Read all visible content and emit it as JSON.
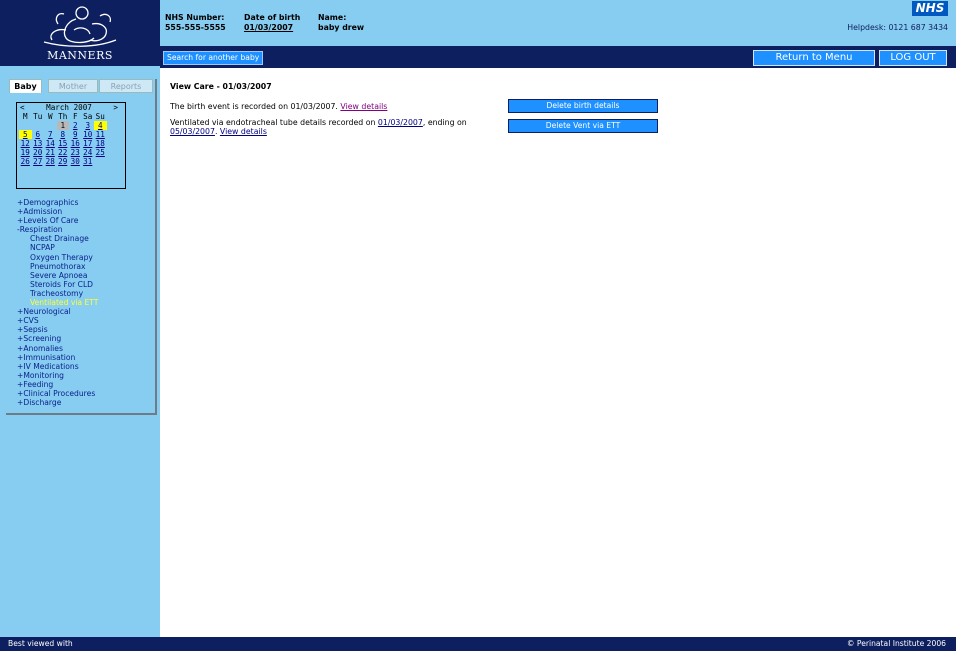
{
  "logo": {
    "brand": "MANNERS"
  },
  "header": {
    "nhs_label": "NHS Number:",
    "nhs_value": "555-555-5555",
    "dob_label": "Date of birth",
    "dob_value": "01/03/2007",
    "name_label": "Name:",
    "name_value": "baby drew",
    "nhs_logo": "NHS",
    "helpdesk": "Helpdesk: 0121 687 3434"
  },
  "nav": {
    "search": "Search for another baby",
    "return": "Return to Menu",
    "logout": "LOG OUT"
  },
  "tabs": [
    "Baby",
    "Mother",
    "Reports"
  ],
  "calendar": {
    "prev": "<",
    "month": "March 2007",
    "next": ">",
    "days": [
      "M",
      "Tu",
      "W",
      "Th",
      "F",
      "Sa",
      "Su"
    ],
    "weeks": [
      [
        "",
        "",
        "",
        "1",
        "2",
        "3",
        "4"
      ],
      [
        "5",
        "6",
        "7",
        "8",
        "9",
        "10",
        "11"
      ],
      [
        "12",
        "13",
        "14",
        "15",
        "16",
        "17",
        "18"
      ],
      [
        "19",
        "20",
        "21",
        "22",
        "23",
        "24",
        "25"
      ],
      [
        "26",
        "27",
        "28",
        "29",
        "30",
        "31",
        ""
      ]
    ]
  },
  "menu": [
    {
      "label": "+Demographics"
    },
    {
      "label": "+Admission"
    },
    {
      "label": "+Levels Of Care"
    },
    {
      "label": "-Respiration"
    },
    {
      "label": "Chest Drainage",
      "sub": true
    },
    {
      "label": "NCPAP",
      "sub": true
    },
    {
      "label": "Oxygen Therapy",
      "sub": true
    },
    {
      "label": "Pneumothorax",
      "sub": true
    },
    {
      "label": "Severe Apnoea",
      "sub": true
    },
    {
      "label": "Steroids For CLD",
      "sub": true
    },
    {
      "label": "Tracheostomy",
      "sub": true
    },
    {
      "label": "Ventilated via ETT",
      "sub": true,
      "current": true
    },
    {
      "label": "+Neurological"
    },
    {
      "label": "+CVS"
    },
    {
      "label": "+Sepsis"
    },
    {
      "label": "+Screening"
    },
    {
      "label": "+Anomalies"
    },
    {
      "label": "+Immunisation"
    },
    {
      "label": "+IV Medications"
    },
    {
      "label": "+Monitoring"
    },
    {
      "label": "+Feeding"
    },
    {
      "label": "+Clinical Procedures"
    },
    {
      "label": "+Discharge"
    }
  ],
  "content": {
    "title": "View Care - 01/03/2007",
    "birth_text": "The birth event is recorded on 01/03/2007.",
    "view_details": "View details",
    "vent_text1": "Ventilated via endotracheal tube details recorded on",
    "vent_date1": "01/03/2007",
    "vent_text2": ", ending on",
    "vent_date2": "05/03/2007",
    "delete_birth": "Delete birth details",
    "delete_vent": "Delete Vent via ETT"
  },
  "footer": {
    "left": "Best viewed with",
    "right": "© Perinatal Institute 2006"
  },
  "colors": {
    "dark_navy": "#0d1f5e",
    "light_blue": "#86cdf1",
    "button_blue": "#1e90ff",
    "highlight_yellow": "#ffff00"
  }
}
